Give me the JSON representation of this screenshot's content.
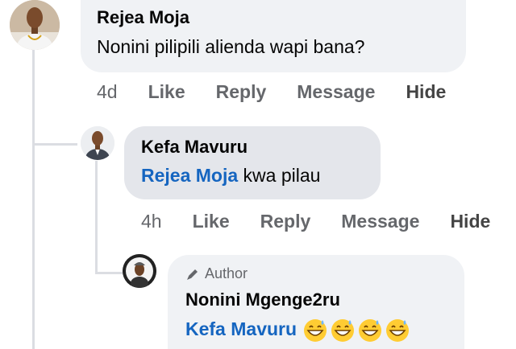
{
  "comments": [
    {
      "author": "Rejea Moja",
      "text": "Nonini  pilipili alienda wapi bana?",
      "actions": {
        "time": "4d",
        "like": "Like",
        "reply": "Reply",
        "message": "Message",
        "hide": "Hide"
      }
    },
    {
      "author": "Kefa Mavuru",
      "mention": "Rejea Moja",
      "text": " kwa pilau",
      "actions": {
        "time": "4h",
        "like": "Like",
        "reply": "Reply",
        "message": "Message",
        "hide": "Hide"
      }
    },
    {
      "badge_icon": "pencil-icon",
      "badge": "Author",
      "author": "Nonini Mgenge2ru",
      "mention": "Kefa Mavuru",
      "emojis": [
        "grinning-sweat-emoji",
        "grinning-sweat-emoji",
        "grinning-sweat-emoji",
        "grinning-sweat-emoji"
      ]
    }
  ],
  "colors": {
    "bubble": "#f0f2f5",
    "bubble_selected": "#e4e6eb",
    "mention": "#1565c0",
    "meta": "#65676b",
    "thread_line": "#dbdde2"
  }
}
